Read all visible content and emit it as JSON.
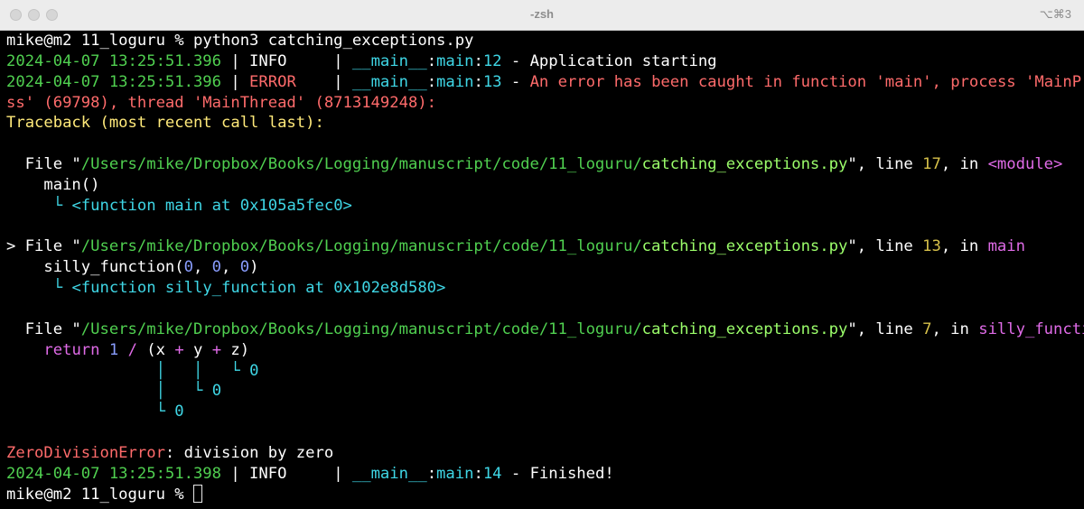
{
  "window": {
    "title": "-zsh",
    "shortcut": "⌥⌘3"
  },
  "lines": {
    "l1": {
      "prompt": "mike@m2 11_loguru % ",
      "cmd": "python3 catching_exceptions.py"
    },
    "l2": {
      "ts": "2024-04-07 13:25:51.396",
      "sep1": " | ",
      "level": "INFO    ",
      "sep2": " | ",
      "mod": "__main__",
      "colon1": ":",
      "func": "main",
      "colon2": ":",
      "line": "12",
      "dash": " - ",
      "msg": "Application starting"
    },
    "l3": {
      "ts": "2024-04-07 13:25:51.396",
      "sep1": " | ",
      "level": "ERROR   ",
      "sep2": " | ",
      "mod": "__main__",
      "colon1": ":",
      "func": "main",
      "colon2": ":",
      "line": "13",
      "dash": " - ",
      "msg": "An error has been caught in function 'main', process 'MainProce"
    },
    "l4": {
      "msg": "ss' (69798), thread 'MainThread' (8713149248):"
    },
    "l5": {
      "text": "Traceback (most recent call last):"
    },
    "f1": {
      "prefix": "  File \"",
      "path": "/Users/mike/Dropbox/Books/Logging/manuscript/code/11_loguru/",
      "file": "catching_exceptions.py",
      "mid": "\", line ",
      "lineno": "17",
      "in": ", in ",
      "func": "<module>"
    },
    "f1code": {
      "text": "    main()"
    },
    "f1val": {
      "indent": "     ",
      "mark": "└",
      "text": " <function main at 0x105a5fec0>"
    },
    "f2": {
      "prefix": "> File \"",
      "path": "/Users/mike/Dropbox/Books/Logging/manuscript/code/11_loguru/",
      "file": "catching_exceptions.py",
      "mid": "\", line ",
      "lineno": "13",
      "in": ", in ",
      "func": "main"
    },
    "f2code": {
      "pre": "    silly_function(",
      "a": "0",
      "c1": ", ",
      "b": "0",
      "c2": ", ",
      "c": "0",
      "post": ")"
    },
    "f2val": {
      "indent": "     ",
      "mark": "└",
      "text": " <function silly_function at 0x102e8d580>"
    },
    "f3": {
      "prefix": "  File \"",
      "path": "/Users/mike/Dropbox/Books/Logging/manuscript/code/11_loguru/",
      "file": "catching_exceptions.py",
      "mid": "\", line ",
      "lineno": "7",
      "in": ", in ",
      "func": "silly_function"
    },
    "f3code": {
      "indent": "    ",
      "kw": "return",
      "sp": " ",
      "num": "1",
      "op1": " / ",
      "open": "(x ",
      "plus1": "+",
      "mid": " y ",
      "plus2": "+",
      "end": " z)"
    },
    "v1": {
      "indent": "                ",
      "bar1": "│",
      "gap": "   ",
      "bar2": "│",
      "gap2": "   ",
      "mark": "└",
      "val": " 0"
    },
    "v2": {
      "indent": "                ",
      "bar1": "│",
      "gap": "   ",
      "mark": "└",
      "val": " 0"
    },
    "v3": {
      "indent": "                ",
      "mark": "└",
      "val": " 0"
    },
    "err": {
      "name": "ZeroDivisionError",
      "colon": ":",
      "msg": " division by zero"
    },
    "l6": {
      "ts": "2024-04-07 13:25:51.398",
      "sep1": " | ",
      "level": "INFO    ",
      "sep2": " | ",
      "mod": "__main__",
      "colon1": ":",
      "func": "main",
      "colon2": ":",
      "line": "14",
      "dash": " - ",
      "msg": "Finished!"
    },
    "l7": {
      "prompt": "mike@m2 11_loguru % "
    }
  }
}
